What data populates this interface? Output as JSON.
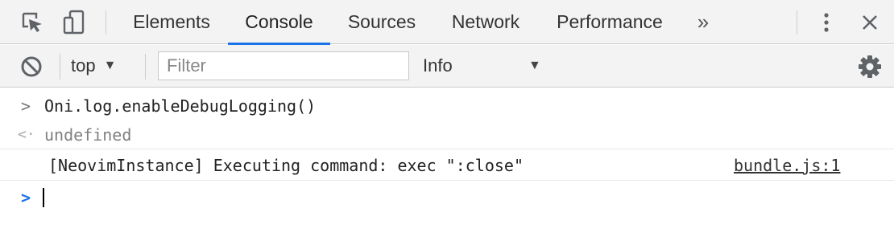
{
  "tabs": {
    "items": [
      {
        "label": "Elements"
      },
      {
        "label": "Console",
        "active": true
      },
      {
        "label": "Sources"
      },
      {
        "label": "Network"
      },
      {
        "label": "Performance"
      }
    ],
    "more_label": "»",
    "icons": {
      "inspect": "inspect-element-icon",
      "device": "device-toolbar-icon",
      "menu": "kebab-menu-icon",
      "close": "close-icon"
    }
  },
  "toolbar": {
    "context_label": "top",
    "filter_placeholder": "Filter",
    "filter_value": "",
    "levels_label": "Info",
    "icons": {
      "clear": "clear-console-icon",
      "settings": "gear-icon"
    }
  },
  "console": {
    "input_glyph": ">",
    "input_text": "Oni.log.enableDebugLogging()",
    "result_glyph": "<·",
    "result_text": "undefined",
    "log_text": "[NeovimInstance] Executing command: exec \":close\"",
    "log_source": "bundle.js:1",
    "prompt_glyph": ">"
  },
  "colors": {
    "accent": "#1a73e8",
    "toolbar_bg": "#f3f3f3",
    "border": "#cccccc"
  }
}
